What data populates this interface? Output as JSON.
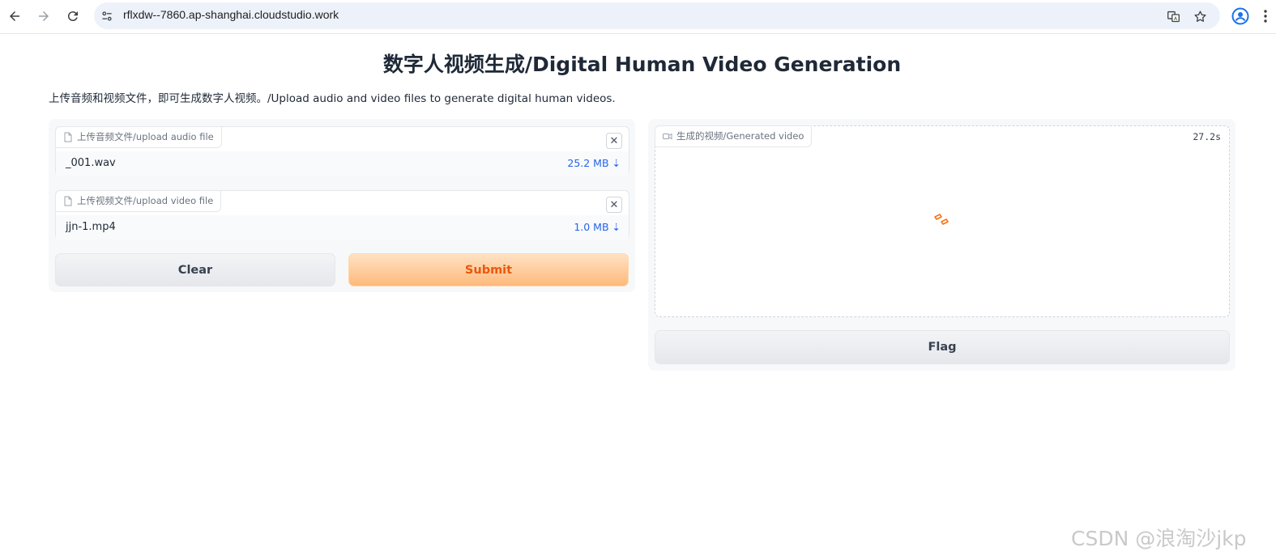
{
  "browser": {
    "url": "rflxdw--7860.ap-shanghai.cloudstudio.work"
  },
  "page": {
    "title": "数字人视频生成/Digital Human Video Generation",
    "description": "上传音频和视频文件，即可生成数字人视频。/Upload audio and video files to generate digital human videos."
  },
  "inputs": {
    "audio": {
      "label": "上传音频文件/upload audio file",
      "file_name": "_001.wav",
      "file_size": "25.2 MB ⇣"
    },
    "video": {
      "label": "上传视频文件/upload video file",
      "file_name": "jjn-1.mp4",
      "file_size": "1.0 MB ⇣"
    }
  },
  "buttons": {
    "clear": "Clear",
    "submit": "Submit",
    "flag": "Flag"
  },
  "output": {
    "label": "生成的视频/Generated video",
    "timer": "27.2s"
  },
  "watermark": "CSDN @浪淘沙jkp",
  "colors": {
    "accent": "#ea580c",
    "link": "#2563eb",
    "address_bar": "#edf2fa"
  }
}
